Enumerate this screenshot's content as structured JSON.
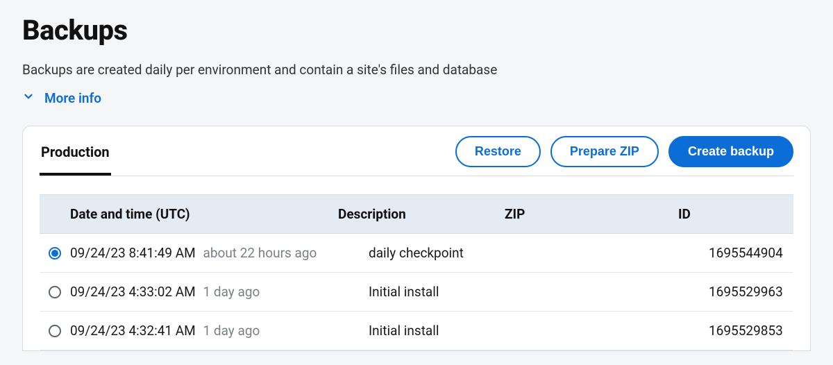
{
  "page": {
    "title": "Backups",
    "subtitle": "Backups are created daily per environment and contain a site's files and database",
    "more_info": "More info"
  },
  "tabs": [
    {
      "label": "Production"
    }
  ],
  "actions": {
    "restore": "Restore",
    "prepare_zip": "Prepare ZIP",
    "create_backup": "Create backup"
  },
  "table": {
    "headers": {
      "date": "Date and time (UTC)",
      "description": "Description",
      "zip": "ZIP",
      "id": "ID"
    },
    "rows": [
      {
        "selected": true,
        "datetime": "09/24/23 8:41:49 AM",
        "relative": "about 22 hours ago",
        "description": "daily checkpoint",
        "zip": "",
        "id": "1695544904"
      },
      {
        "selected": false,
        "datetime": "09/24/23 4:33:02 AM",
        "relative": "1 day ago",
        "description": "Initial install",
        "zip": "",
        "id": "1695529963"
      },
      {
        "selected": false,
        "datetime": "09/24/23 4:32:41 AM",
        "relative": "1 day ago",
        "description": "Initial install",
        "zip": "",
        "id": "1695529853"
      }
    ]
  }
}
